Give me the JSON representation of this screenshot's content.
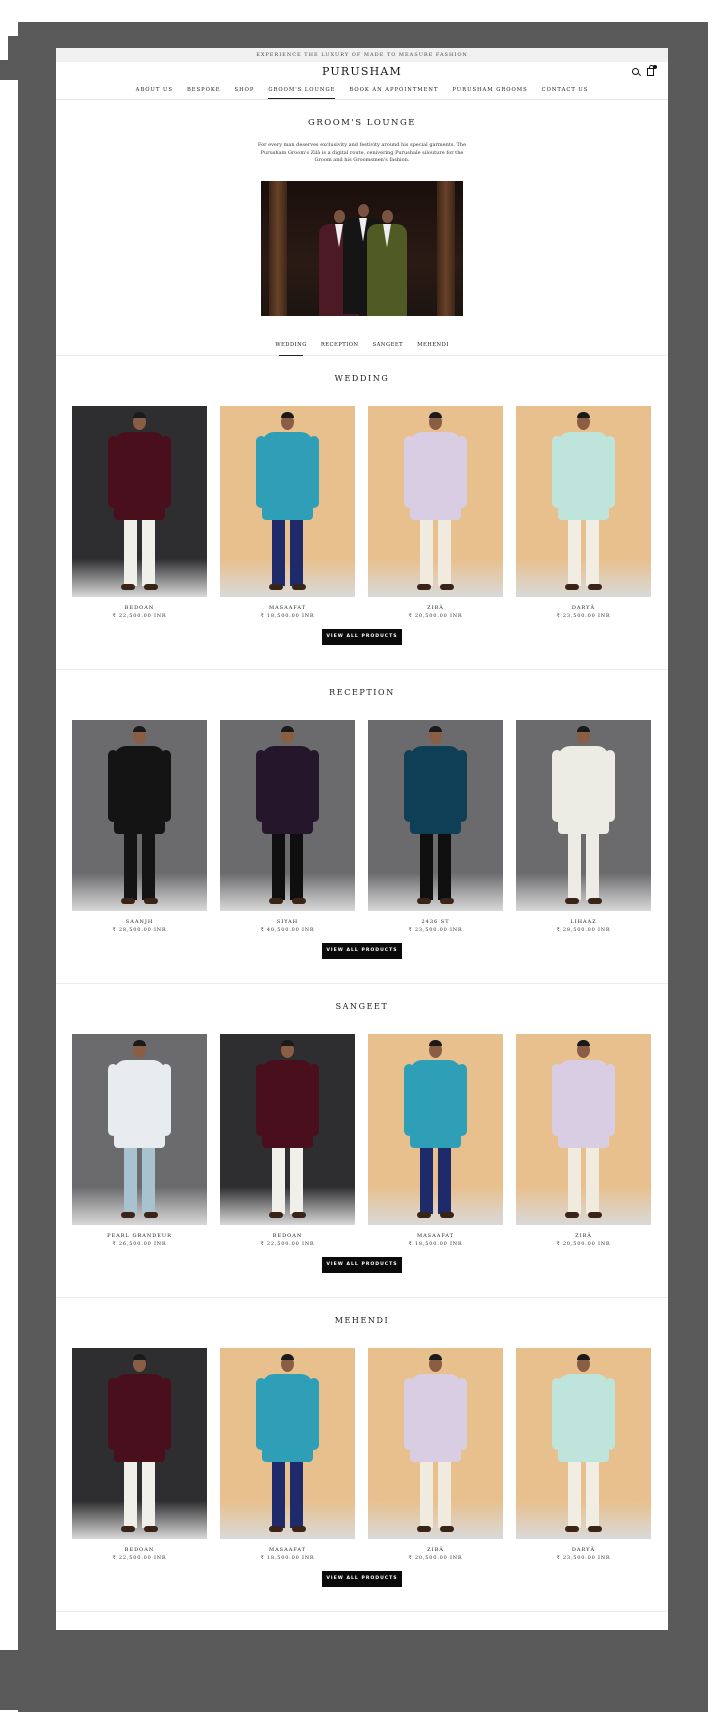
{
  "announcement": "EXPERIENCE THE LUXURY OF MADE TO MEASURE FASHION",
  "brand": "PURUSHAM",
  "nav": [
    "ABOUT US",
    "BESPOKE",
    "SHOP",
    "GROOM'S LOUNGE",
    "BOOK AN APPOINTMENT",
    "PURUSHAM GROOMS",
    "CONTACT US"
  ],
  "nav_active": "GROOM'S LOUNGE",
  "lounge": {
    "title": "GROOM'S LOUNGE",
    "description": "For every man deserves exclusivity and festivity around his special garments. The Purusham Groom's Zilā is a digital route, cenivering Purushale silouture for the Groom and his Groomsmen's fashion."
  },
  "tabs": [
    "WEDDING",
    "RECEPTION",
    "SANGEET",
    "MEHENDI"
  ],
  "tab_active": "WEDDING",
  "view_all_label": "VIEW ALL PRODUCTS",
  "sections": [
    {
      "title": "WEDDING",
      "products": [
        {
          "name": "BEDOAN",
          "price": "₹ 22,500.00 INR",
          "bg": "#2e2e30",
          "jacket": "#4a0f1c",
          "pants": "#f1efe9"
        },
        {
          "name": "MASAAFAT",
          "price": "₹ 18,500.00 INR",
          "bg": "#e8c08e",
          "jacket": "#2f9fb8",
          "pants": "#1f2a6a"
        },
        {
          "name": "ZIBĀ",
          "price": "₹ 20,500.00 INR",
          "bg": "#e8c08e",
          "jacket": "#d8cde3",
          "pants": "#f0eadf"
        },
        {
          "name": "DARYĀ",
          "price": "₹ 23,500.00 INR",
          "bg": "#e8c08e",
          "jacket": "#bfe4dc",
          "pants": "#f1ede3"
        }
      ]
    },
    {
      "title": "RECEPTION",
      "products": [
        {
          "name": "SAANJH",
          "price": "₹ 28,500.00 INR",
          "bg": "#6b6b6e",
          "jacket": "#141414",
          "pants": "#141414"
        },
        {
          "name": "SIYAH",
          "price": "₹ 40,500.00 INR",
          "bg": "#6b6b6e",
          "jacket": "#25162c",
          "pants": "#0f0f0f"
        },
        {
          "name": "2436 ST",
          "price": "₹ 23,500.00 INR",
          "bg": "#6b6b6e",
          "jacket": "#0f3e57",
          "pants": "#0f0f0f"
        },
        {
          "name": "LIHAAZ",
          "price": "₹ 28,500.00 INR",
          "bg": "#6b6b6e",
          "jacket": "#ecebe4",
          "pants": "#ecebe4"
        }
      ]
    },
    {
      "title": "SANGEET",
      "products": [
        {
          "name": "PEARL GRANDEUR",
          "price": "₹ 26,500.00 INR",
          "bg": "#6b6b6e",
          "jacket": "#e8ecef",
          "pants": "#a9c2cf"
        },
        {
          "name": "BEDOAN",
          "price": "₹ 22,500.00 INR",
          "bg": "#2e2e30",
          "jacket": "#4a0f1c",
          "pants": "#f1efe9"
        },
        {
          "name": "MASAAFAT",
          "price": "₹ 18,500.00 INR",
          "bg": "#e8c08e",
          "jacket": "#2f9fb8",
          "pants": "#1f2a6a"
        },
        {
          "name": "ZIBĀ",
          "price": "₹ 20,500.00 INR",
          "bg": "#e8c08e",
          "jacket": "#d8cde3",
          "pants": "#f0eadf"
        }
      ]
    },
    {
      "title": "MEHENDI",
      "products": [
        {
          "name": "BEDOAN",
          "price": "₹ 22,500.00 INR",
          "bg": "#2e2e30",
          "jacket": "#4a0f1c",
          "pants": "#f1efe9"
        },
        {
          "name": "MASAAFAT",
          "price": "₹ 18,500.00 INR",
          "bg": "#e8c08e",
          "jacket": "#2f9fb8",
          "pants": "#1f2a6a"
        },
        {
          "name": "ZIBĀ",
          "price": "₹ 20,500.00 INR",
          "bg": "#e8c08e",
          "jacket": "#d8cde3",
          "pants": "#f0eadf"
        },
        {
          "name": "DARYĀ",
          "price": "₹ 23,500.00 INR",
          "bg": "#e8c08e",
          "jacket": "#bfe4dc",
          "pants": "#f1ede3"
        }
      ]
    }
  ],
  "colors": {
    "frame": "#5a5a5a",
    "button_bg": "#0a0a0a",
    "accent": "#111111"
  },
  "icons": [
    "search-icon",
    "bag-icon"
  ]
}
